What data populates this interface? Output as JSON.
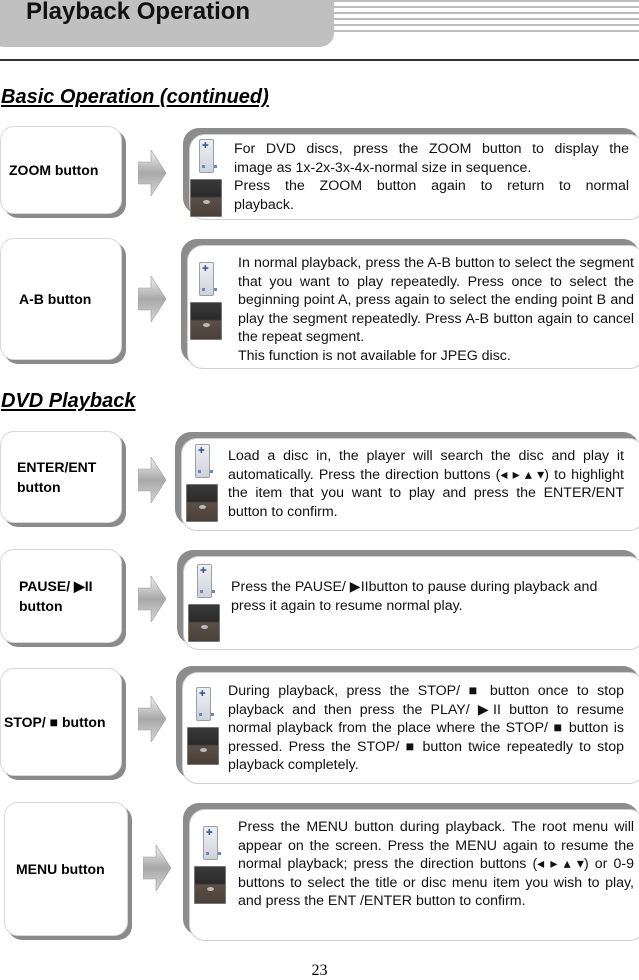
{
  "header": {
    "title": "Playback Operation"
  },
  "sections": [
    {
      "title": "Basic Operation (continued)"
    },
    {
      "title": "DVD Playback"
    }
  ],
  "items": [
    {
      "label": "ZOOM button",
      "description": "For DVD discs, press the ZOOM button to display the image as 1x-2x-3x-4x-normal size in sequence. Press the ZOOM button again to return to normal playback."
    },
    {
      "label": "A-B button",
      "description": "In normal playback, press the A-B button to select the segment that you want to play repeatedly. Press once to select the beginning point A, press again to select the ending point B and play the segment repeatedly. Press A-B button again to cancel the repeat segment. This function is not available for JPEG disc."
    },
    {
      "label": "ENTER/ENT button",
      "description": "Load a disc in, the player will search the disc and play it automatically. Press the direction buttons (◂ ▸ ▴ ▾) to highlight the item that you want to play and press the ENTER/ENT button to confirm."
    },
    {
      "label": "PAUSE/ ▶II button",
      "description": "Press the PAUSE/ ▶IIbutton to pause during playback and press it again to resume normal play."
    },
    {
      "label": "STOP/ ■ button",
      "description": "During playback, press the STOP/ ■ button once to stop playback and then press the PLAY/ ▶II button to resume normal playback from the place where the STOP/ ■ button is pressed. Press the STOP/ ■ button twice repeatedly to stop playback completely."
    },
    {
      "label": "MENU button",
      "description": "Press the MENU button during playback. The root menu will appear on the screen. Press the MENU again to resume the normal playback; press the direction buttons (◂ ▸ ▴ ▾) or 0-9 buttons to select the title or disc menu item you wish to play, and press the ENT /ENTER button to confirm."
    }
  ],
  "zoom_text": {
    "l1": "For DVD discs, press the ZOOM button to display the",
    "l2": "image as 1x-2x-3x-4x-normal size in sequence.",
    "l3": "Press the ZOOM button again to return to normal",
    "l4": "playback."
  },
  "ab_text": {
    "p1": "In normal playback, press the A-B button to select the segment that you want to play repeatedly. Press once to select the beginning point A, press again to select the ending point B and play the segment repeatedly. Press A-B button again to cancel the repeat segment.",
    "p2": "This function is not available for JPEG disc."
  },
  "enter_label": {
    "l1": "ENTER/ENT",
    "l2": "button"
  },
  "pause_label": {
    "l1": "PAUSE/ ▶II",
    "l2": "button"
  },
  "page_number": "23"
}
